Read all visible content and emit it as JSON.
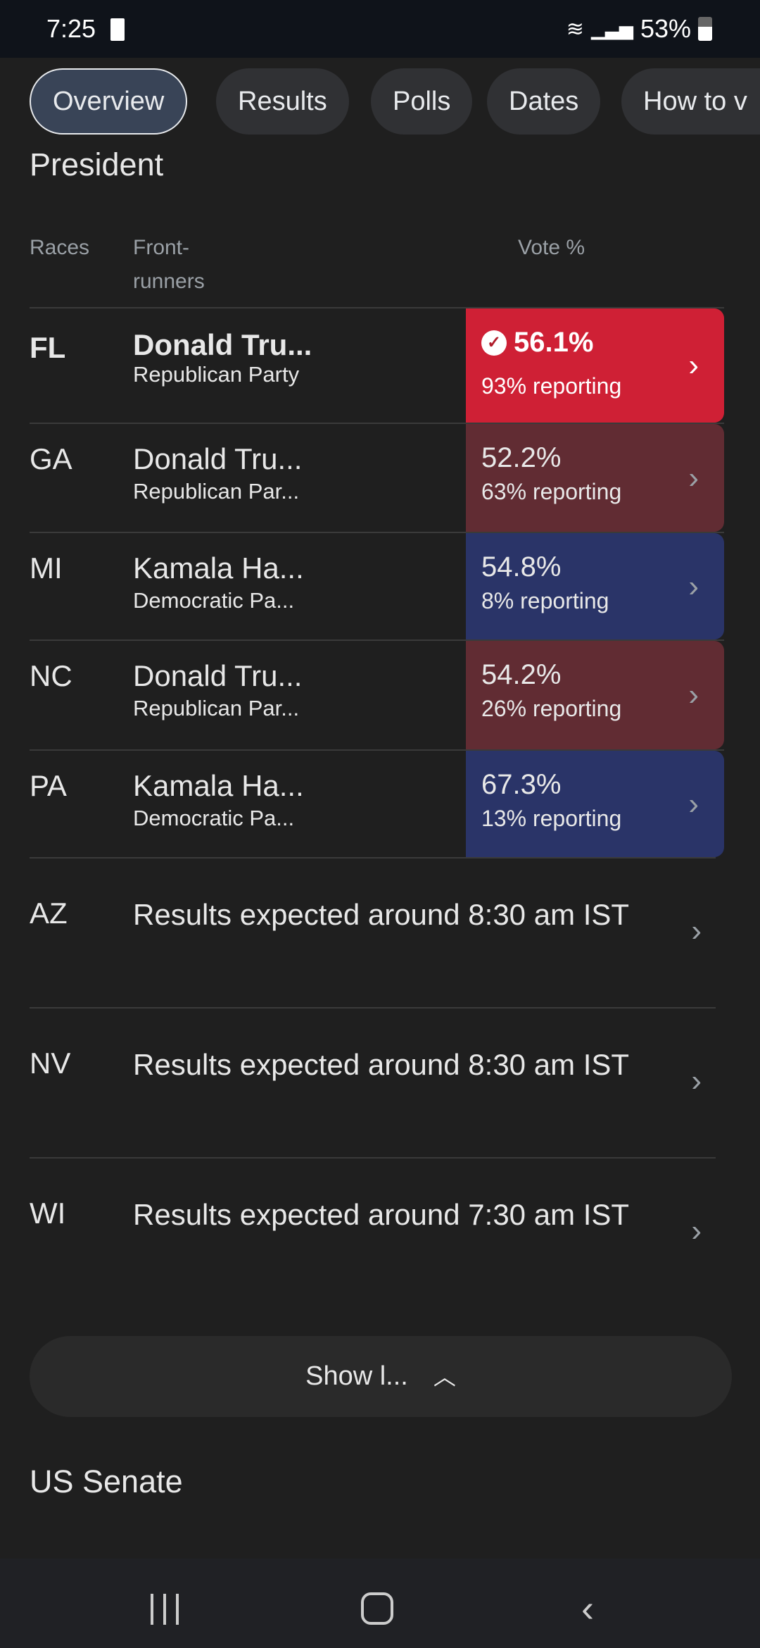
{
  "status_bar": {
    "time": "7:25",
    "battery": "53%"
  },
  "tabs": [
    {
      "label": "Overview",
      "active": true
    },
    {
      "label": "Results"
    },
    {
      "label": "Polls"
    },
    {
      "label": "Dates"
    },
    {
      "label": "How to v"
    }
  ],
  "president": {
    "title": "President",
    "headers": {
      "races": "Races",
      "frontrunners_1": "Front-",
      "frontrunners_2": "runners",
      "vote": "Vote %"
    },
    "rows": [
      {
        "state": "FL",
        "candidate": "Donald Tru...",
        "party": "Republican Party",
        "vote": "56.1%",
        "reporting": "93% reporting",
        "color": "#cf2035",
        "winner": true
      },
      {
        "state": "GA",
        "candidate": "Donald Tru...",
        "party": "Republican Par...",
        "vote": "52.2%",
        "reporting": "63% reporting",
        "color": "#612c33"
      },
      {
        "state": "MI",
        "candidate": "Kamala Ha...",
        "party": "Democratic Pa...",
        "vote": "54.8%",
        "reporting": "8% reporting",
        "color": "#2a3468"
      },
      {
        "state": "NC",
        "candidate": "Donald Tru...",
        "party": "Republican Par...",
        "vote": "54.2%",
        "reporting": "26% reporting",
        "color": "#612c33"
      },
      {
        "state": "PA",
        "candidate": "Kamala Ha...",
        "party": "Democratic Pa...",
        "vote": "67.3%",
        "reporting": "13% reporting",
        "color": "#2a3468"
      }
    ],
    "pending": [
      {
        "state": "AZ",
        "text": "Results expected around 8:30 am IST"
      },
      {
        "state": "NV",
        "text": "Results expected around 8:30 am IST"
      },
      {
        "state": "WI",
        "text": "Results expected around 7:30 am IST"
      }
    ],
    "show_less": "Show l..."
  },
  "senate": {
    "title": "US Senate"
  }
}
